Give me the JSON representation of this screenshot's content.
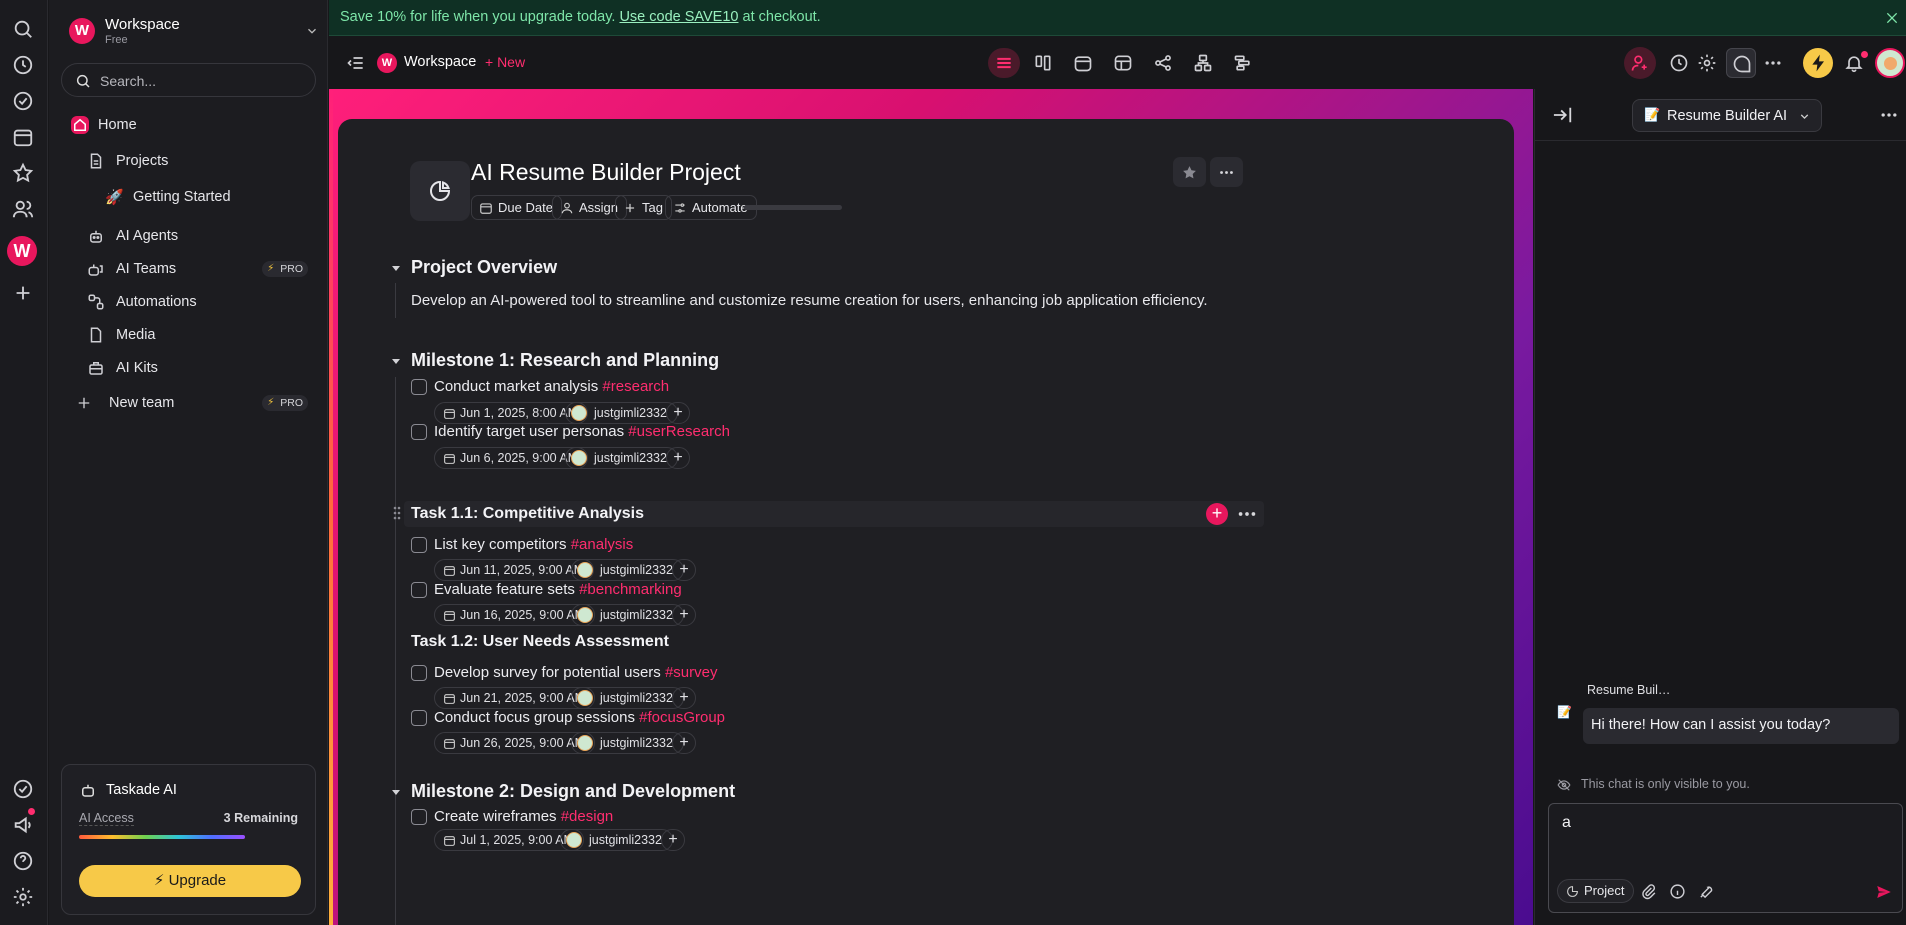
{
  "promo": {
    "text": "Save 10% for life when you upgrade today.",
    "link": "Use code SAVE10",
    "suffix": " at checkout."
  },
  "rail": {
    "icons": [
      "search-icon",
      "history-icon",
      "check-circle-icon",
      "calendar-icon",
      "star-icon",
      "people-icon",
      "add-icon",
      "feedback-icon",
      "announcements-icon",
      "help-icon",
      "settings-icon"
    ],
    "workspace_letter": "W"
  },
  "workspace": {
    "letter": "W",
    "name": "Workspace",
    "plan": "Free"
  },
  "sidebar": {
    "search_placeholder": "Search...",
    "items": [
      {
        "label": "Home",
        "icon": "home-icon"
      },
      {
        "label": "Projects",
        "icon": "document-icon"
      },
      {
        "label": "Getting Started",
        "icon": "rocket-icon",
        "emoji": "🚀"
      },
      {
        "label": "AI Agents",
        "icon": "robot-icon"
      },
      {
        "label": "AI Teams",
        "icon": "robot-team-icon",
        "badge": "PRO"
      },
      {
        "label": "Automations",
        "icon": "automation-icon"
      },
      {
        "label": "Media",
        "icon": "media-icon"
      },
      {
        "label": "AI Kits",
        "icon": "kit-icon"
      },
      {
        "label": "New team",
        "icon": "plus-icon",
        "badge": "PRO"
      }
    ]
  },
  "ai_card": {
    "title": "Taskade AI",
    "access_label": "AI Access",
    "remaining": "3 Remaining",
    "usage_fraction": 0.8,
    "upgrade_label": "Upgrade"
  },
  "topbar": {
    "crumb_logo": "W",
    "workspace_name": "Workspace",
    "new_label": "+ New",
    "view_icons": [
      "list-view-icon",
      "board-view-icon",
      "calendar-view-icon",
      "table-view-icon",
      "mindmap-view-icon",
      "org-chart-view-icon",
      "gantt-view-icon"
    ],
    "right_icons": [
      "share-icon",
      "history-icon",
      "settings-icon",
      "chat-icon",
      "more-icon",
      "bolt-icon",
      "bell-icon",
      "avatar"
    ]
  },
  "project": {
    "title": "AI Resume Builder Project",
    "chips": [
      "Due Date",
      "Assign",
      "Tag",
      "Automate"
    ]
  },
  "outline": {
    "overview_heading": "Project Overview",
    "overview_text": "Develop an AI-powered tool to streamline and customize resume creation for users, enhancing job application efficiency.",
    "milestone1": "Milestone 1: Research and Planning",
    "task11": "Task 1.1: Competitive Analysis",
    "task12": "Task 1.2: User Needs Assessment",
    "milestone2": "Milestone 2: Design and Development",
    "tasks": [
      {
        "text": "Conduct market analysis",
        "tag": "#research",
        "date": "Jun 1, 2025, 8:00 AM",
        "user": "justgimli2332"
      },
      {
        "text": "Identify target user personas",
        "tag": "#userResearch",
        "date": "Jun 6, 2025, 9:00 AM",
        "user": "justgimli2332"
      },
      {
        "text": "List key competitors",
        "tag": "#analysis",
        "date": "Jun 11, 2025, 9:00 AM",
        "user": "justgimli2332"
      },
      {
        "text": "Evaluate feature sets",
        "tag": "#benchmarking",
        "date": "Jun 16, 2025, 9:00 AM",
        "user": "justgimli2332"
      },
      {
        "text": "Develop survey for potential users",
        "tag": "#survey",
        "date": "Jun 21, 2025, 9:00 AM",
        "user": "justgimli2332"
      },
      {
        "text": "Conduct focus group sessions",
        "tag": "#focusGroup",
        "date": "Jun 26, 2025, 9:00 AM",
        "user": "justgimli2332"
      },
      {
        "text": "Create wireframes",
        "tag": "#design",
        "date": "Jul 1, 2025, 9:00 AM",
        "user": "justgimli2332"
      }
    ]
  },
  "chat": {
    "agent_emoji": "📝",
    "agent_name": "Resume Builder AI",
    "message_author": "Resume Buil…",
    "message_text": "Hi there! How can I assist you today?",
    "visibility_note": "This chat is only visible to you.",
    "input_value": "a",
    "project_chip": "Project"
  },
  "colors": {
    "accent": "#e8175d",
    "tag": "#ff2d6f",
    "promo_bg": "#0f3024",
    "promo_text": "#7ee6a9",
    "upgrade": "#f7c948"
  }
}
